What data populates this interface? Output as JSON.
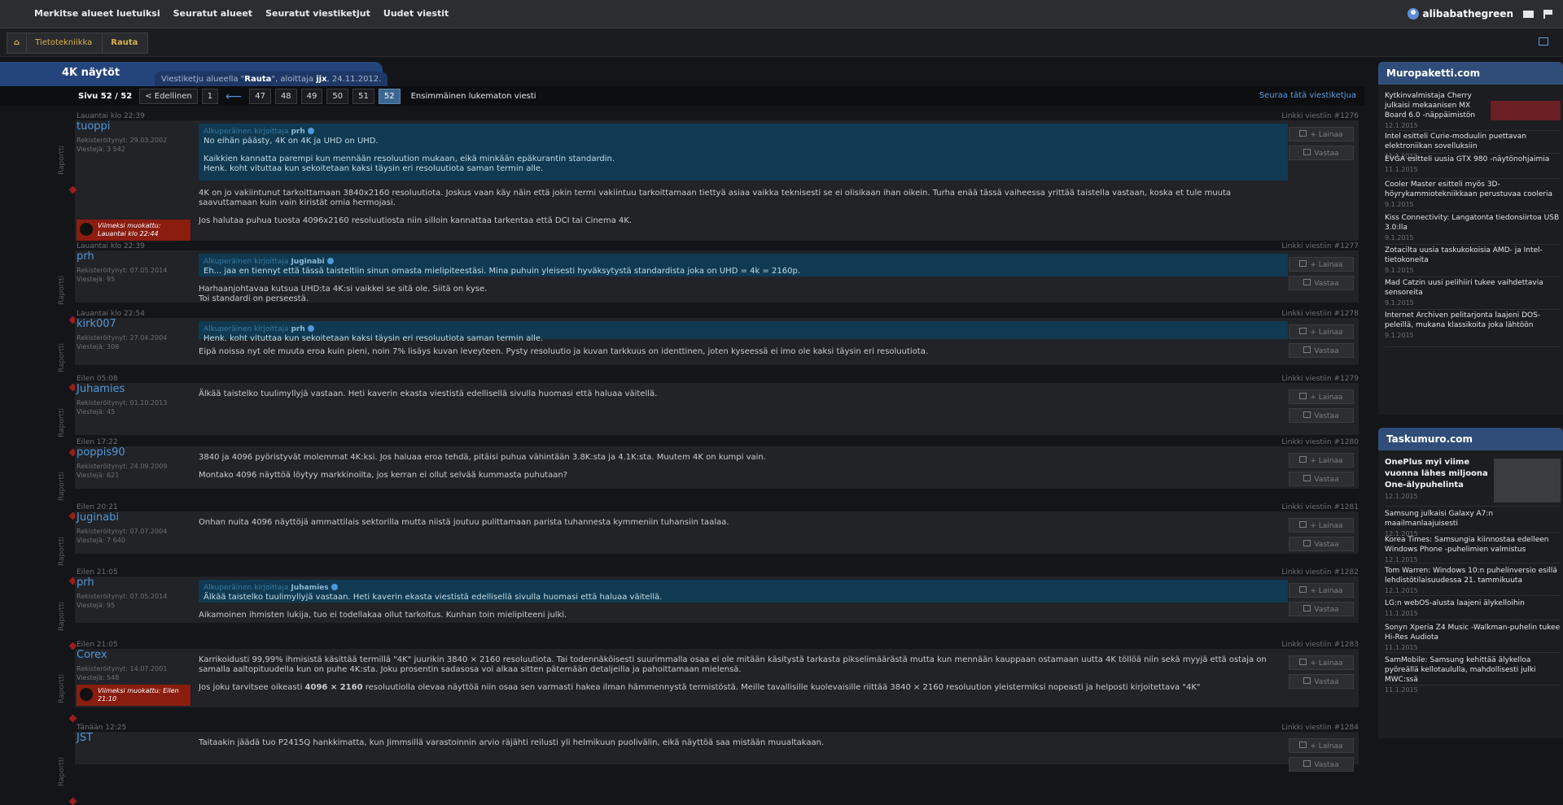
{
  "topnav": [
    {
      "label": "Merkitse alueet luetuiksi"
    },
    {
      "label": "Seuratut alueet"
    },
    {
      "label": "Seuratut viestiketjut"
    },
    {
      "label": "Uudet viestit"
    }
  ],
  "user": {
    "name": "alibabathegreen"
  },
  "breadcrumb": {
    "items": [
      "Tietotekniikka",
      "Rauta"
    ]
  },
  "thread": {
    "title": "4K näytöt",
    "info_prefix": "Viestiketju alueella",
    "info_area": "Rauta",
    "info_mid": ", aloittaja",
    "info_author": "jjx",
    "info_date": ", 24.11.2012."
  },
  "pager": {
    "label": "Sivu 52 / 52",
    "prev": "< Edellinen",
    "pages": [
      "1",
      "47",
      "48",
      "49",
      "50",
      "51",
      "52"
    ],
    "current": "52",
    "first_unread": "Ensimmäinen lukematon viesti",
    "follow": "Seuraa tätä viestiketjua"
  },
  "actions": {
    "quote": "+ Lainaa",
    "reply": "Vastaa"
  },
  "raportti": "Raportti",
  "posts": [
    {
      "date": "Lauantai klo 22:39",
      "link": "Linkki viestiin #1276",
      "user": "tuoppi",
      "joined": "Rekisteröitynyt: 29.03.2002",
      "count": "Viestejä: 3 542",
      "edited_label": "Viimeksi muokattu:",
      "edited_date": "Lauantai klo 22:44",
      "quote_head": "Alkuperäinen kirjoittaja",
      "quote_author": "prh",
      "quote_lines": [
        "No eihän päästy, 4K on 4K ja UHD on UHD.",
        "",
        "Kaikkien kannatta parempi kun mennään resoluution mukaan, eikä minkään epäkurantin standardin.",
        "Henk. koht vituttaa kun sekoitetaan kaksi täysin eri resoluutiota saman termin alle."
      ],
      "lines": [
        "4K on jo vakiintunut tarkoittamaan 3840x2160 resoluutiota. Joskus vaan käy näin että jokin termi vakiintuu tarkoittamaan tiettyä asiaa vaikka teknisesti se ei olisikaan ihan oikein. Turha enää tässä vaiheessa yrittää taistella vastaan, koska et tule muuta saavuttamaan kuin vain kiristät omia hermojasi.",
        "",
        "Jos halutaa puhua tuosta 4096x2160 resoluutiosta niin silloin kannattaa tarkentaa että DCI tai Cinema 4K."
      ]
    },
    {
      "date": "Lauantai klo 22:39",
      "link": "Linkki viestiin #1277",
      "user": "prh",
      "joined": "Rekisteröitynyt: 07.05.2014",
      "count": "Viestejä: 95",
      "quote_head": "Alkuperäinen kirjoittaja",
      "quote_author": "Juginabi",
      "quote_lines": [
        "Eh... jaa en tiennyt että tässä taisteltiin sinun omasta mielipiteestäsi. Mina puhuin yleisesti hyväksytystä standardista joka on UHD = 4k = 2160p."
      ],
      "lines": [
        "Harhaanjohtavaa kutsua UHD:ta 4K:si vaikkei se sitä ole. Siitä on kyse.",
        "Toi standardi on perseestä."
      ]
    },
    {
      "date": "Lauantai klo 22:54",
      "link": "Linkki viestiin #1278",
      "user": "kirk007",
      "joined": "Rekisteröitynyt: 27.04.2004",
      "count": "Viestejä: 308",
      "quote_head": "Alkuperäinen kirjoittaja",
      "quote_author": "prh",
      "quote_lines": [
        "Henk. koht vituttaa kun sekoitetaan kaksi täysin eri resoluutiota saman termin alle."
      ],
      "lines": [
        "Eipä noissa nyt ole muuta eroa kuin pieni, noin 7% lisäys kuvan leveyteen. Pysty resoluutio ja kuvan tarkkuus on identtinen, joten kyseessä ei imo ole kaksi täysin eri resoluutiota."
      ]
    },
    {
      "date": "Eilen 05:08",
      "link": "Linkki viestiin #1279",
      "user": "Juhamies",
      "joined": "Rekisteröitynyt: 01.10.2013",
      "count": "Viestejä: 45",
      "lines": [
        "Älkää taistelko tuulimyllyjä vastaan. Heti kaverin ekasta viestistä edellisellä sivulla huomasi että haluaa väitellä."
      ]
    },
    {
      "date": "Eilen 17:22",
      "link": "Linkki viestiin #1280",
      "user": "poppis90",
      "joined": "Rekisteröitynyt: 24.09.2009",
      "count": "Viestejä: 621",
      "lines": [
        "3840 ja 4096 pyöristyvät molemmat 4K:ksi. Jos haluaa eroa tehdä, pitäisi puhua vähintään 3.8K:sta ja 4.1K:sta. Muutem 4K on kumpi vain.",
        "",
        "Montako 4096 näyttöä löytyy markkinoilta, jos kerran ei ollut selvää kummasta puhutaan?"
      ]
    },
    {
      "date": "Eilen 20:21",
      "link": "Linkki viestiin #1281",
      "user": "Juginabi",
      "joined": "Rekisteröitynyt: 07.07.2004",
      "count": "Viestejä: 7 640",
      "lines": [
        "Onhan nuita 4096 näyttöjä ammattilais sektorilla mutta niistä joutuu pulittamaan parista tuhannesta kymmeniin tuhansiin taalaa."
      ]
    },
    {
      "date": "Eilen 21:05",
      "link": "Linkki viestiin #1282",
      "user": "prh",
      "joined": "Rekisteröitynyt: 07.05.2014",
      "count": "Viestejä: 95",
      "quote_head": "Alkuperäinen kirjoittaja",
      "quote_author": "Juhamies",
      "quote_lines": [
        "Älkää taistelko tuulimyllyjä vastaan. Heti kaverin ekasta viestistä edellisellä sivulla huomasi että haluaa väitellä."
      ],
      "lines": [
        "Aikamoinen ihmisten lukija, tuo ei todellakaa ollut tarkoitus. Kunhan toin mielipiteeni julki."
      ]
    },
    {
      "date": "Eilen 21:05",
      "link": "Linkki viestiin #1283",
      "user": "Corex",
      "joined": "Rekisteröitynyt: 14.07.2001",
      "count": "Viestejä: 548",
      "edited_label": "Viimeksi muokattu: Eilen",
      "edited_date": "21:10",
      "lines": [
        "Karrikoidusti 99,99% ihmisistä käsittää termillä \"4K\" juurikin 3840 × 2160 resoluutiota. Tai todennäköisesti suurimmalla osaa ei ole mitään käsitystä tarkasta pikselimäärästä mutta kun mennään kauppaan ostamaan uutta 4K töllöä niin sekä myyjä että ostaja on samalla aaltopituudella kun on puhe 4K:sta. Joku prosentin sadasosa voi alkaa sitten pätemään detaljeilla ja pahoittamaan mielensä.",
        ""
      ],
      "last_pre": "Jos joku tarvitsee oikeasti ",
      "last_bold": "4096 × 2160",
      "last_post": " resoluutiolla olevaa näyttöä niin osaa sen varmasti hakea ilman hämmennystä termistöstä. Meille tavallisille kuolevaisille riittää 3840 × 2160 resoluution yleistermiksi nopeasti ja helposti kirjoitettava \"4K\""
    },
    {
      "date": "Tänään 12:25",
      "link": "Linkki viestiin #1284",
      "user": "JST",
      "joined": "",
      "count": "",
      "lines": [
        "Taitaakin jäädä tuo P2415Q hankkimatta, kun Jimmsillä varastoinnin arvio räjähti reilusti yli helmikuun puolivälin, eikä näyttöä saa mistään muualtakaan."
      ]
    }
  ],
  "sidebar": {
    "muro": {
      "title": "Muropaketti.com",
      "items": [
        {
          "title": "Kytkinvalmistaja Cherry julkaisi mekaanisen MX Board 6.0 -näppäimistön",
          "date": "12.1.2015"
        },
        {
          "title": "Intel esitteli Curie-moduulin puettavan elektroniikan sovelluksiin",
          "date": "11.1.2015"
        },
        {
          "title": "EVGA esitteli uusia GTX 980 -näytönohjaimia",
          "date": "11.1.2015"
        },
        {
          "title": "Cooler Master esitteli myös 3D-höyrykammiotekniikkaan perustuvaa cooleria",
          "date": "9.1.2015"
        },
        {
          "title": "Kiss Connectivity: Langatonta tiedonsiirtoa USB 3.0:lla",
          "date": "9.1.2015"
        },
        {
          "title": "Zotacilta uusia taskukokoisia AMD- ja Intel-tietokoneita",
          "date": "9.1.2015"
        },
        {
          "title": "Mad Catzin uusi pelihiiri tukee vaihdettavia sensoreita",
          "date": "9.1.2015"
        },
        {
          "title": "Internet Archiven pelitarjonta laajeni DOS-peleillä, mukana klassikoita joka lähtöön",
          "date": "9.1.2015"
        }
      ]
    },
    "tasku": {
      "title": "Taskumuro.com",
      "items": [
        {
          "title": "OnePlus myi viime vuonna lähes miljoona One-älypuhelinta",
          "date": "12.1.2015"
        },
        {
          "title": "Samsung julkaisi Galaxy A7:n maailmanlaajuisesti",
          "date": "12.1.2015"
        },
        {
          "title": "Korea Times: Samsungia kiinnostaa edelleen Windows Phone -puhelimien valmistus",
          "date": "12.1.2015"
        },
        {
          "title": "Tom Warren: Windows 10:n puhelinversio esillä lehdistötilaisuudessa 21. tammikuuta",
          "date": "12.1.2015"
        },
        {
          "title": "LG:n webOS-alusta laajeni älykelloihin",
          "date": "11.1.2015"
        },
        {
          "title": "Sonyn Xperia Z4 Music -Walkman-puhelin tukee Hi-Res Audiota",
          "date": "11.1.2015"
        },
        {
          "title": "SamMobile: Samsung kehittää älykelloa pyöreällä kellotaululla, mahdollisesti julki MWC:ssä",
          "date": "11.1.2015"
        }
      ]
    }
  },
  "colors": {
    "accent": "#4f97dc",
    "header_blue": "#24447c",
    "quote_bg": "#0f3a52",
    "edited_red": "#8a1d0f"
  }
}
